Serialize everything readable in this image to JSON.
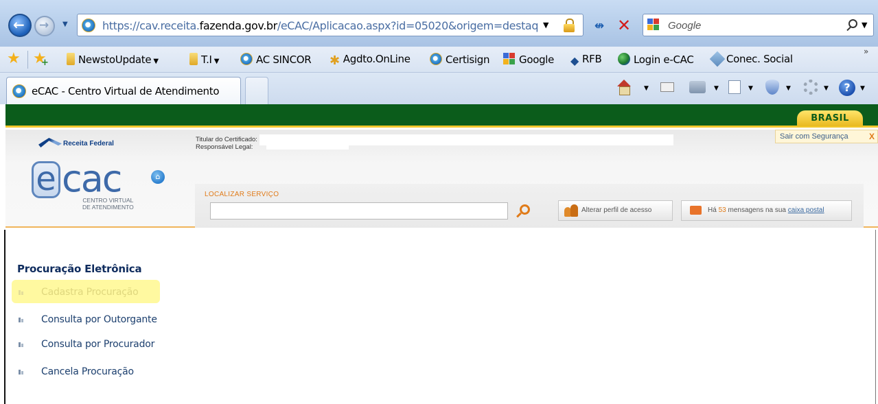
{
  "browser": {
    "url_prefix": "https://cav.receita.",
    "url_domain": "fazenda.gov.br",
    "url_suffix": "/eCAC/Aplicacao.aspx?id=05020&origem=destaq",
    "search_provider": "Google",
    "favorites": [
      {
        "label": "NewstoUpdate",
        "icon": "folder-icon",
        "dropdown": true
      },
      {
        "label": "T.I",
        "icon": "folder-icon",
        "dropdown": true
      },
      {
        "label": "AC SINCOR",
        "icon": "ie-icon"
      },
      {
        "label": "Agdto.OnLine",
        "icon": "star-icon"
      },
      {
        "label": "Certisign",
        "icon": "ie-icon"
      },
      {
        "label": "Google",
        "icon": "google-icon"
      },
      {
        "label": "RFB",
        "icon": "rfb-icon"
      },
      {
        "label": "Login e-CAC",
        "icon": "globe-icon"
      },
      {
        "label": "Conec. Social",
        "icon": "diamond-icon"
      }
    ],
    "favorites_more": "»",
    "tab_title": "eCAC - Centro Virtual de Atendimento"
  },
  "page": {
    "brasil_badge": "BRASIL",
    "receita_logo": "Receita Federal",
    "ecac_e": "e",
    "ecac_cac": "cac",
    "ecac_sub_1": "CENTRO VIRTUAL",
    "ecac_sub_2": "DE ATENDIMENTO",
    "cert_titular_label": "Titular do Certificado:",
    "cert_responsavel_label": "Responsável Legal:",
    "sair_label": "Sair com Segurança",
    "sair_close": "X",
    "search_label": "LOCALIZAR SERVIÇO",
    "search_value": "",
    "alterar_perfil": "Alterar perfil de acesso",
    "mensagens_prefix": "Há",
    "mensagens_count": "53",
    "mensagens_middle": "mensagens na sua",
    "mensagens_link": "caixa postal",
    "section_title": "Procuração Eletrônica",
    "menu": [
      {
        "label": "Cadastra Procuração",
        "highlighted": true
      },
      {
        "label": "Consulta por Outorgante"
      },
      {
        "label": "Consulta por Procurador"
      },
      {
        "label": "Cancela Procuração"
      }
    ]
  },
  "colors": {
    "gov_green": "#0b5c1b",
    "brasil_yellow": "#f3c72c",
    "accent_orange": "#e07b19",
    "highlight_yellow": "#fff9a0",
    "menu_text": "#1c3f6e"
  }
}
